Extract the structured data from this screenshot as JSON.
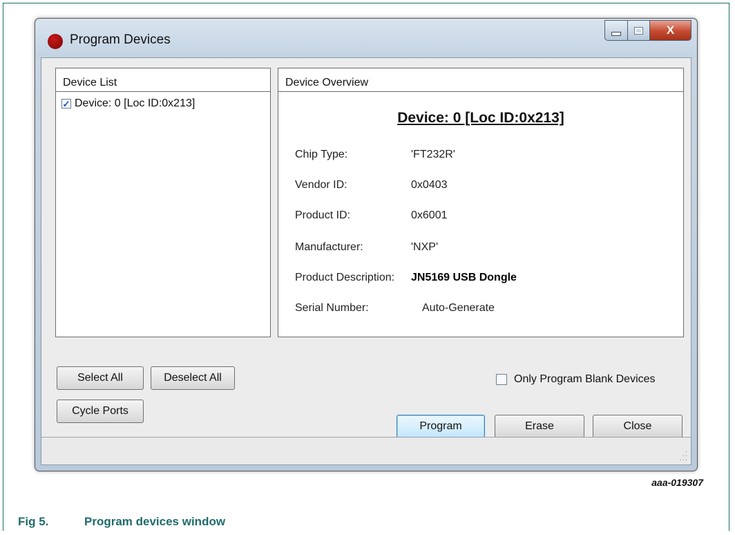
{
  "window": {
    "title": "Program Devices",
    "close_glyph": "X",
    "brand_color": "#b01010"
  },
  "device_list": {
    "header": "Device List",
    "items": [
      {
        "label": "Device: 0 [Loc ID:0x213]",
        "checked": true,
        "check_glyph": "✓"
      }
    ]
  },
  "device_overview": {
    "header": "Device Overview",
    "title": "Device: 0 [Loc ID:0x213]",
    "properties": [
      {
        "label": "Chip Type:",
        "value": "'FT232R'"
      },
      {
        "label": "Vendor ID:",
        "value": "0x0403"
      },
      {
        "label": "Product ID:",
        "value": "0x6001"
      },
      {
        "label": "Manufacturer:",
        "value": "'NXP'"
      },
      {
        "label": "Product Description:",
        "value": "JN5169 USB Dongle"
      },
      {
        "label": "Serial Number:",
        "value": "Auto-Generate"
      }
    ]
  },
  "buttons": {
    "select_all": "Select All",
    "deselect_all": "Deselect All",
    "cycle_ports": "Cycle Ports",
    "program": "Program",
    "erase": "Erase",
    "close": "Close"
  },
  "options": {
    "only_program_blank": "Only Program Blank Devices",
    "only_program_blank_checked": false
  },
  "figure": {
    "id": "aaa-019307",
    "number": "Fig 5.",
    "caption": "Program devices window",
    "caption_color": "#1f6b6b"
  }
}
